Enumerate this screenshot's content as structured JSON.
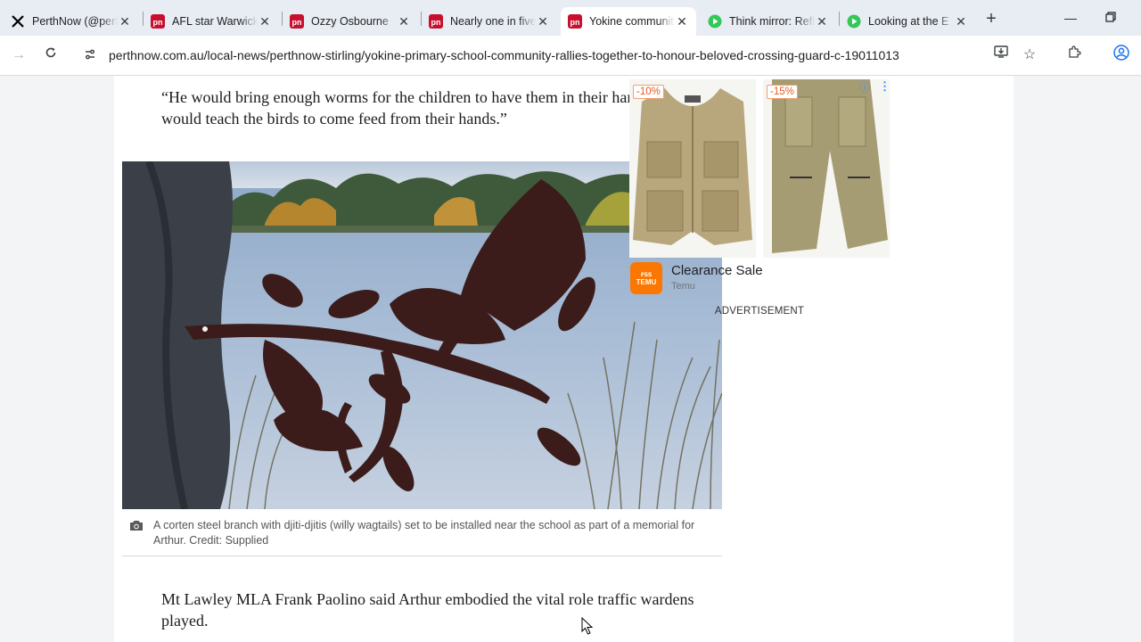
{
  "tabs": [
    {
      "title": "PerthNow (@perthnow)",
      "favicon": "x-logo-icon"
    },
    {
      "title": "AFL star Warwick",
      "favicon": "perthnow-icon"
    },
    {
      "title": "Ozzy Osbourne",
      "favicon": "perthnow-icon"
    },
    {
      "title": "Nearly one in five",
      "favicon": "perthnow-icon"
    },
    {
      "title": "Yokine community",
      "favicon": "perthnow-icon",
      "active": true
    },
    {
      "title": "Think mirror: Reflect",
      "favicon": "play-icon"
    },
    {
      "title": "Looking at the E",
      "favicon": "play-icon"
    }
  ],
  "toolbar": {
    "url": "perthnow.com.au/local-news/perthnow-stirling/yokine-primary-school-community-rallies-together-to-honour-beloved-crossing-guard-c-19011013"
  },
  "article": {
    "quote": "“He would bring enough worms for the children to have them in their hand, and he would teach the birds to come feed from their hands.”",
    "photo_alt": "corten steel branch with willy wagtails sculpture",
    "caption": "A corten steel branch with djiti-djitis (willy wagtails) set to be installed near the school as part of a memorial for Arthur. Credit: Supplied",
    "paragraph": "Mt Lawley MLA Frank Paolino said Arthur embodied the vital role traffic wardens played."
  },
  "ad": {
    "discount_left": "-10%",
    "discount_right": "-15%",
    "title": "Clearance Sale",
    "source": "Temu",
    "logo_text_top": "ꜰꜱꜱ",
    "logo_text": "TEMU",
    "label": "ADVERTISEMENT"
  },
  "colors": {
    "accent_perthnow": "#c8102e",
    "temu_orange": "#fb7701",
    "tabstrip": "#e8ecf3"
  }
}
